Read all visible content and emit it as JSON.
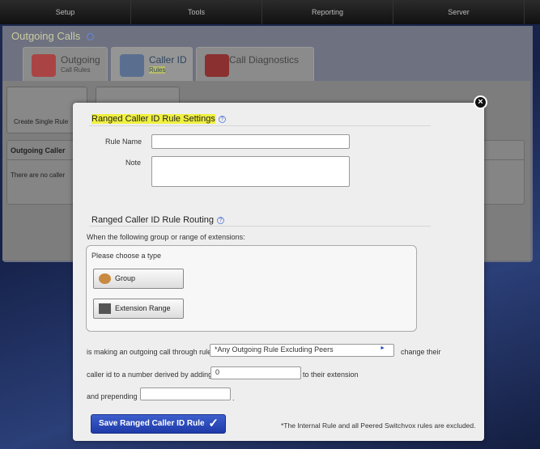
{
  "nav": {
    "items": [
      "Setup",
      "Tools",
      "Reporting",
      "Server"
    ]
  },
  "page": {
    "title": "Outgoing Calls"
  },
  "tabs": [
    {
      "label": "Outgoing",
      "sub": "Call Rules"
    },
    {
      "label": "Caller ID",
      "sub": "Rules"
    },
    {
      "label": "Call Diagnostics",
      "sub": ""
    }
  ],
  "toolbar": {
    "create_single": "Create Single Rule"
  },
  "background_panel": {
    "header": "Outgoing Caller",
    "empty": "There are no caller"
  },
  "modal": {
    "settings_title": "Ranged Caller ID Rule Settings",
    "rule_name_label": "Rule Name",
    "rule_name_value": "",
    "note_label": "Note",
    "note_value": "",
    "routing_title": "Ranged Caller ID Rule Routing",
    "routing_intro": "When the following group or range of extensions:",
    "choose_type": "Please choose a type",
    "group_button": "Group",
    "ext_range_button": "Extension Range",
    "through_rule_label": "is making an outgoing call through rule",
    "rule_select_value": "*Any Outgoing Rule Excluding Peers",
    "change_their": "change their",
    "adding_label": "caller id to a number derived by adding",
    "adding_value": "0",
    "to_ext": "to their extension",
    "prepending_label": "and prepending",
    "prepending_value": "",
    "period": ".",
    "save_button": "Save Ranged Caller ID Rule",
    "footnote": "*The Internal Rule and all Peered Switchvox rules are excluded."
  },
  "colors": {
    "highlight": "#f0f040",
    "save_button": "#2a48b8"
  }
}
